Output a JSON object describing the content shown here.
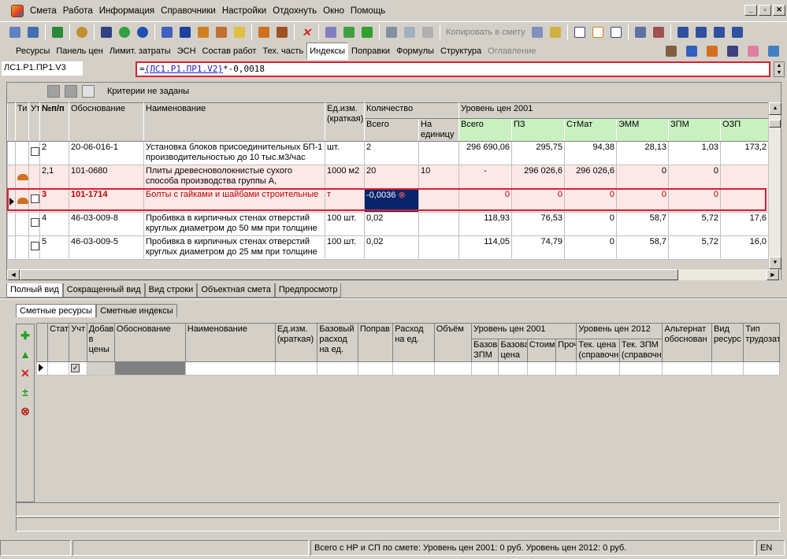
{
  "menu": [
    "Смета",
    "Работа",
    "Информация",
    "Справочники",
    "Настройки",
    "Отдохнуть",
    "Окно",
    "Помощь"
  ],
  "window_controls": [
    "_",
    "▫",
    "✕"
  ],
  "toolbar": {
    "copy_label": "Копировать в смету"
  },
  "tabs": [
    "Ресурсы",
    "Панель цен",
    "Лимит. затраты",
    "ЭСН",
    "Состав работ",
    "Тех. часть",
    "Индексы",
    "Поправки",
    "Формулы",
    "Структура",
    "Оглавление"
  ],
  "tabs_selected": "Индексы",
  "tabs_disabled": "Оглавление",
  "cell_ref": "ЛС1.Р1.ПР1.V3",
  "formula": {
    "prefix": "=",
    "ref": "{ЛС1.Р1.ПР1.V2}",
    "suffix": "*-0,0018"
  },
  "criteria": "Критерии не заданы",
  "grid": {
    "headers": {
      "type": "Ти",
      "counted": "Ут",
      "num": "№п/п",
      "basis": "Обоснование",
      "name": "Наименование",
      "unit": "Ед.изм. (краткая)",
      "qty_group": "Количество",
      "qty_total": "Всего",
      "qty_per_unit": "На единицу",
      "price_group": "Уровень цен 2001",
      "price_total": "Всего",
      "pz": "ПЗ",
      "stmat": "СтМат",
      "emm": "ЭММ",
      "zpm": "ЗПМ",
      "ozp": "ОЗП"
    },
    "rows": [
      {
        "num": "2",
        "basis": "20-06-016-1",
        "name": "Установка блоков присоединительных БП-1 производительностью до 10 тыс.м3/час",
        "unit": "шт.",
        "qty": "2",
        "per_unit": "",
        "total": "296 690,06",
        "pz": "295,75",
        "stmat": "94,38",
        "emm": "28,13",
        "zpm": "1,03",
        "ozp": "173,2"
      },
      {
        "num": "2,1",
        "basis": "101-0680",
        "name": "Плиты древесноволокнистые сухого способа производства группы А,",
        "unit": "1000 м2",
        "qty": "20",
        "per_unit": "10",
        "total": "-",
        "pz": "296 026,6",
        "stmat": "296 026,6",
        "emm": "0",
        "zpm": "0",
        "ozp": ""
      },
      {
        "num": "3",
        "basis": "101-1714",
        "name": "Болты с гайками и шайбами строительные",
        "unit": "т",
        "qty": "-0,0036",
        "per_unit": "",
        "total": "0",
        "pz": "0",
        "stmat": "0",
        "emm": "0",
        "zpm": "0",
        "ozp": ""
      },
      {
        "num": "4",
        "basis": "46-03-009-8",
        "name": "Пробивка в кирпичных стенах отверстий круглых диаметром до 50 мм при толщине",
        "unit": "100 шт.",
        "qty": "0,02",
        "per_unit": "",
        "total": "118,93",
        "pz": "76,53",
        "stmat": "0",
        "emm": "58,7",
        "zpm": "5,72",
        "ozp": "17,6"
      },
      {
        "num": "5",
        "basis": "46-03-009-5",
        "name": "Пробивка в кирпичных стенах отверстий круглых диаметром до 25 мм при толщине",
        "unit": "100 шт.",
        "qty": "0,02",
        "per_unit": "",
        "total": "114,05",
        "pz": "74,79",
        "stmat": "0",
        "emm": "58,7",
        "zpm": "5,72",
        "ozp": "16,0"
      }
    ]
  },
  "view_tabs": [
    "Полный вид",
    "Сокращенный вид",
    "Вид строки",
    "Объектная смета",
    "Предпросмотр"
  ],
  "sub_tabs": [
    "Сметные ресурсы",
    "Сметные индексы"
  ],
  "grid2": {
    "headers": {
      "status": "Стат",
      "counted": "Учт",
      "added": "Добав в цены",
      "basis": "Обоснование",
      "name": "Наименование",
      "unit": "Ед.изм. (краткая)",
      "base_rate": "Базовый расход на ед.",
      "correction": "Поправ",
      "rate": "Расход на ед.",
      "volume": "Объём",
      "level2001": "Уровень цен 2001",
      "base_zpm": "Базовая ЗПМ",
      "base_price": "Базовая цена",
      "cost": "Стоим",
      "other": "Проч",
      "level2012": "Уровень цен 2012",
      "cur_price": "Тек. цена (справочн",
      "cur_zpm": "Тек. ЗПМ (справочн",
      "alt_basis": "Альтернат обоснован",
      "res_type": "Вид ресурс",
      "labor_type": "Тип трудозат"
    }
  },
  "status": {
    "total": "Всего с НР и СП по смете: Уровень цен 2001: 0 руб. Уровень цен 2012: 0 руб.",
    "lang": "EN"
  }
}
